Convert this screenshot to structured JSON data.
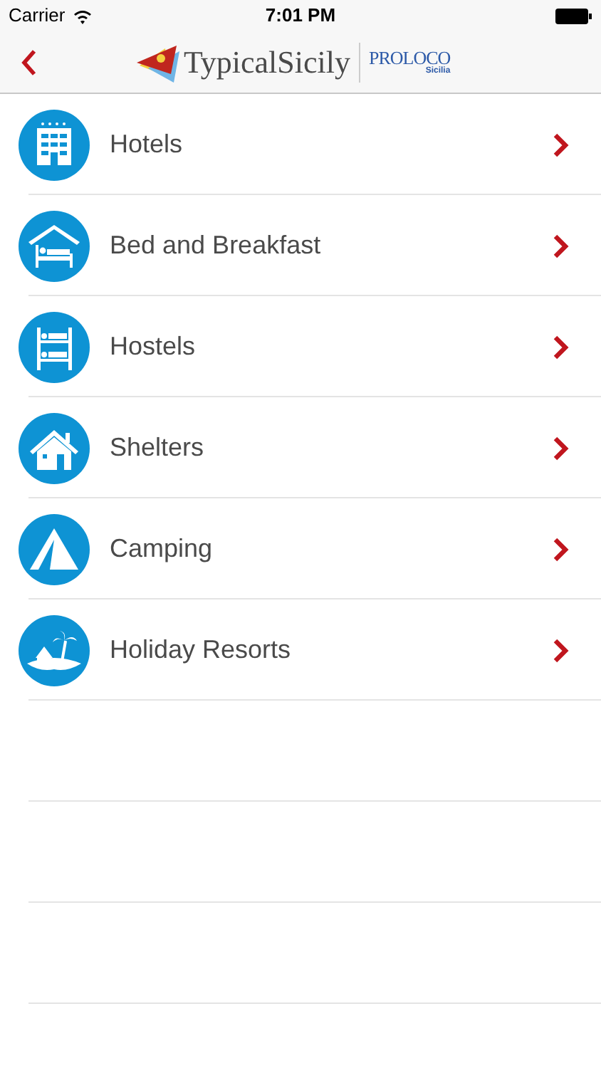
{
  "status_bar": {
    "carrier": "Carrier",
    "time": "7:01 PM"
  },
  "nav": {
    "logo_text": "TypicalSicily",
    "partner_text": "PROLOCO",
    "partner_subtext": "Sicilia"
  },
  "items": [
    {
      "label": "Hotels",
      "kind": "hotel"
    },
    {
      "label": "Bed and Breakfast",
      "kind": "bed"
    },
    {
      "label": "Hostels",
      "kind": "bunk"
    },
    {
      "label": "Shelters",
      "kind": "house"
    },
    {
      "label": "Camping",
      "kind": "tent"
    },
    {
      "label": "Holiday Resorts",
      "kind": "island"
    }
  ]
}
